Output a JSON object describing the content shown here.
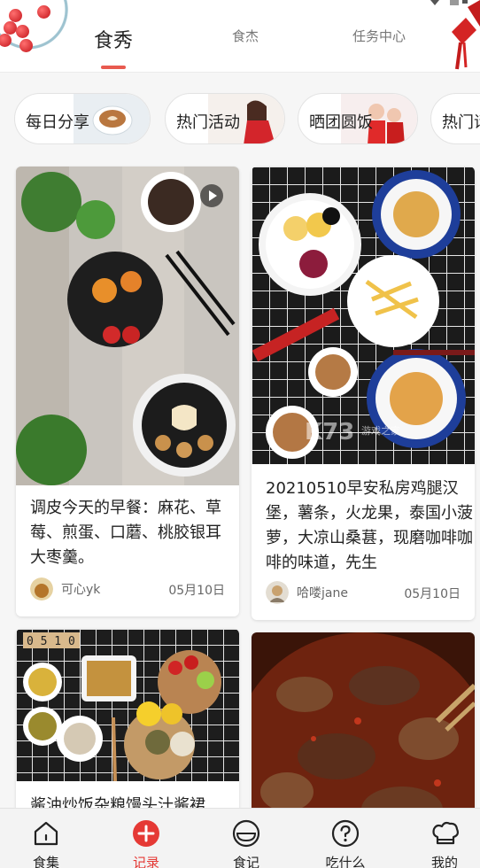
{
  "header": {
    "tabs": [
      {
        "label": "食秀",
        "active": true
      },
      {
        "label": "食杰",
        "active": false
      },
      {
        "label": "任务中心",
        "active": false
      }
    ],
    "accent_color": "#e85a4f"
  },
  "categories": [
    {
      "label": "每日分享"
    },
    {
      "label": "热门活动"
    },
    {
      "label": "晒团圆饭"
    },
    {
      "label": "热门话"
    }
  ],
  "feed": [
    {
      "title": "调皮今天的早餐：麻花、草莓、煎蛋、口蘑、桃胶银耳大枣羹。",
      "author": "可心yk",
      "date": "05月10日",
      "has_video": true
    },
    {
      "title": "20210510早安私房鸡腿汉堡，薯条，火龙果，泰国小菠萝，大凉山桑葚，现磨咖啡咖啡的味道，先生",
      "author": "哈喽jane",
      "date": "05月10日",
      "has_video": false
    },
    {
      "title": "酱油炒饭杂粮馒头汁酱裙",
      "photo_text": "0 5 1 0",
      "has_video": false
    },
    {
      "title": "",
      "has_video": false
    }
  ],
  "watermark": {
    "text": "K73",
    "subtext": "游戏之家"
  },
  "bottom_nav": [
    {
      "label": "食集",
      "icon": "home-icon",
      "active": false
    },
    {
      "label": "记录",
      "icon": "plus-circle-icon",
      "active": true
    },
    {
      "label": "食记",
      "icon": "bowl-icon",
      "active": false
    },
    {
      "label": "吃什么",
      "icon": "question-icon",
      "active": false
    },
    {
      "label": "我的",
      "icon": "chef-hat-icon",
      "active": false
    }
  ],
  "colors": {
    "active": "#e53935",
    "text": "#222222",
    "muted": "#666666"
  }
}
